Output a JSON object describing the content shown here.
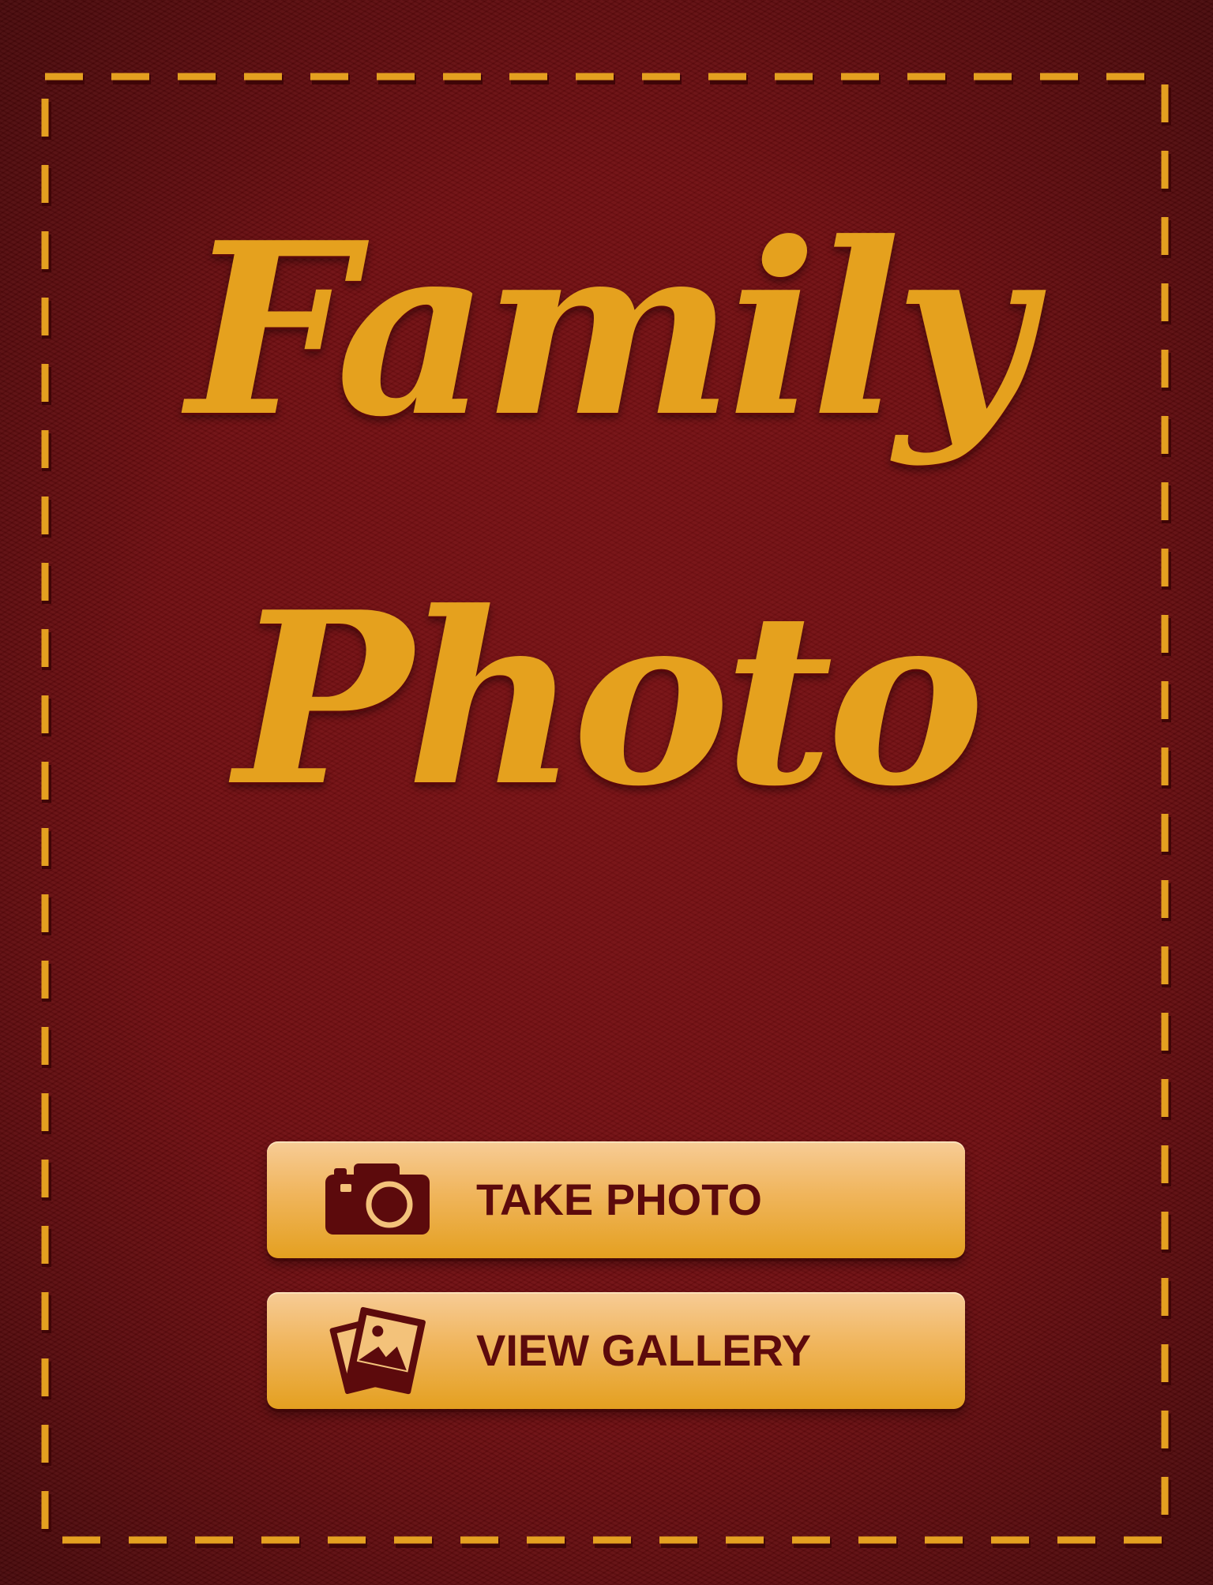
{
  "app": {
    "title_line1": "Family",
    "title_line2": "Photo"
  },
  "actions": {
    "take_photo_label": "TAKE PHOTO",
    "take_photo_icon": "camera-icon",
    "view_gallery_label": "VIEW GALLERY",
    "view_gallery_icon": "photos-icon"
  },
  "colors": {
    "background": "#6e0d10",
    "accent_gold": "#e5a11e",
    "button_light": "#f7cc96",
    "button_dark": "#e4a020",
    "button_text": "#5c0a0c"
  }
}
